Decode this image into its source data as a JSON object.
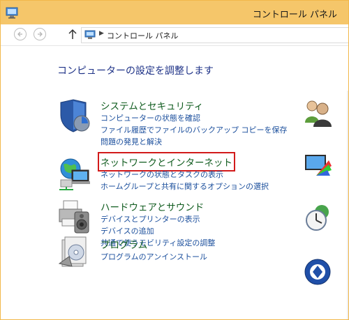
{
  "window": {
    "title": "コントロール パネル"
  },
  "address": {
    "path": "コントロール パネル"
  },
  "page": {
    "heading": "コンピューターの設定を調整します"
  },
  "categories": [
    {
      "title": "システムとセキュリティ",
      "links": [
        "コンピューターの状態を確認",
        "ファイル履歴でファイルのバックアップ コピーを保存",
        "問題の発見と解決"
      ]
    },
    {
      "title": "ネットワークとインターネット",
      "links": [
        "ネットワークの状態とタスクの表示",
        "ホームグループと共有に関するオプションの選択"
      ]
    },
    {
      "title": "ハードウェアとサウンド",
      "links": [
        "デバイスとプリンターの表示",
        "デバイスの追加",
        "共通で使うモビリティ設定の調整"
      ]
    },
    {
      "title": "プログラム",
      "links": [
        "プログラムのアンインストール"
      ]
    }
  ],
  "colors": {
    "titlebar": "#f5c66a",
    "heading": "#1e3287",
    "category_title": "#0f5b1e",
    "link": "#1a4e9c",
    "highlight": "#d21a1a"
  }
}
